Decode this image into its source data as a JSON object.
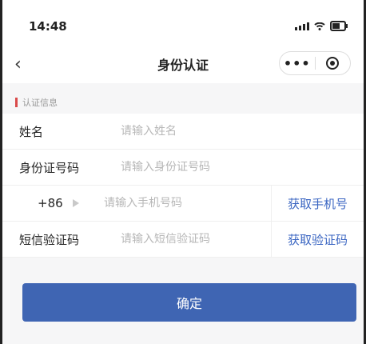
{
  "status_bar": {
    "time": "14:48"
  },
  "nav": {
    "back_icon": "chevron-left-icon",
    "title": "身份认证",
    "more_label": "•••"
  },
  "section": {
    "title": "认证信息"
  },
  "form": {
    "name": {
      "label": "姓名",
      "placeholder": "请输入姓名"
    },
    "id_number": {
      "label": "身份证号码",
      "placeholder": "请输入身份证号码"
    },
    "phone": {
      "country_code": "+86",
      "placeholder": "请输入手机号码",
      "action": "获取手机号"
    },
    "sms": {
      "label": "短信验证码",
      "placeholder": "请输入短信验证码",
      "action": "获取验证码"
    }
  },
  "confirm": {
    "label": "确定"
  },
  "colors": {
    "primary": "#3f65b3",
    "link": "#3b66c2",
    "section_marker": "#d94a4a"
  }
}
